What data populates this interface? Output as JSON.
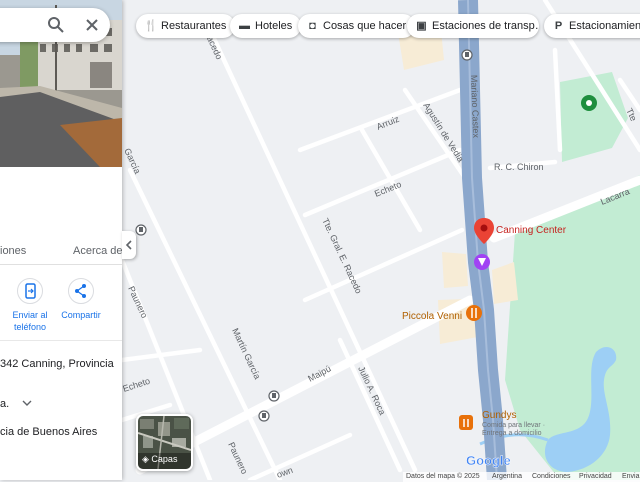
{
  "panel": {
    "search_icon": "search-icon",
    "close_icon": "close-icon",
    "tabs": [
      "iones",
      "Acerca de"
    ],
    "actions": [
      {
        "label_line1": "Enviar al",
        "label_line2": "teléfono",
        "icon": "send-to-phone-icon"
      },
      {
        "label_line1": "Compartir",
        "label_line2": "",
        "icon": "share-icon"
      }
    ],
    "address": "342 Canning, Provincia",
    "hours_text": "a.",
    "region": "cia de Buenos Aires"
  },
  "chips": [
    {
      "label": "Restaurantes",
      "icon": "fork-knife-icon"
    },
    {
      "label": "Hoteles",
      "icon": "bed-icon"
    },
    {
      "label": "Cosas que hacer",
      "icon": "camera-icon"
    },
    {
      "label": "Estaciones de transp…",
      "icon": "train-icon"
    },
    {
      "label": "Estacionamiento",
      "icon": "parking-icon"
    }
  ],
  "streets": {
    "mariano_castex": "Mariano Castex",
    "agustin_de_vedia": "Agustín de Vedia",
    "arruiz": "Arruiz",
    "echeto_top": "Echeto",
    "echeto_bottom": "Echeto",
    "rc_chiron": "R. C. Chiron",
    "lacarra": "Lacarra",
    "raccedo": "Tte. Gral. E. Racedo",
    "raccedo_top": "Racedo",
    "martin_garcia": "Martín García",
    "garcia_left": "García",
    "paunero": "Paunero",
    "paunero_bottom": "Paunero",
    "maipu": "Maipú",
    "julio_roca": "Julio A. Roca",
    "town": "own",
    "tte": "Tte"
  },
  "places": {
    "canning_center": "Canning Center",
    "piccola_venni": "Piccola Venni",
    "gundys": "Gundys",
    "gundys_line1": "Comida para llevar ·",
    "gundys_line2": "Entrega a domicilio"
  },
  "layers_label": "Capas",
  "brand": "Google",
  "footer": [
    "Datos del mapa © 2025",
    "Argentina",
    "Condiciones",
    "Privacidad",
    "Envia"
  ],
  "colors": {
    "highway": "#8ba7cc",
    "park": "#c2ecd3",
    "water": "#9dcff5",
    "pin_red": "#ea4335",
    "poi_orange": "#e8710a",
    "poi_purple": "#a142f4",
    "link_blue": "#1a73e8"
  }
}
